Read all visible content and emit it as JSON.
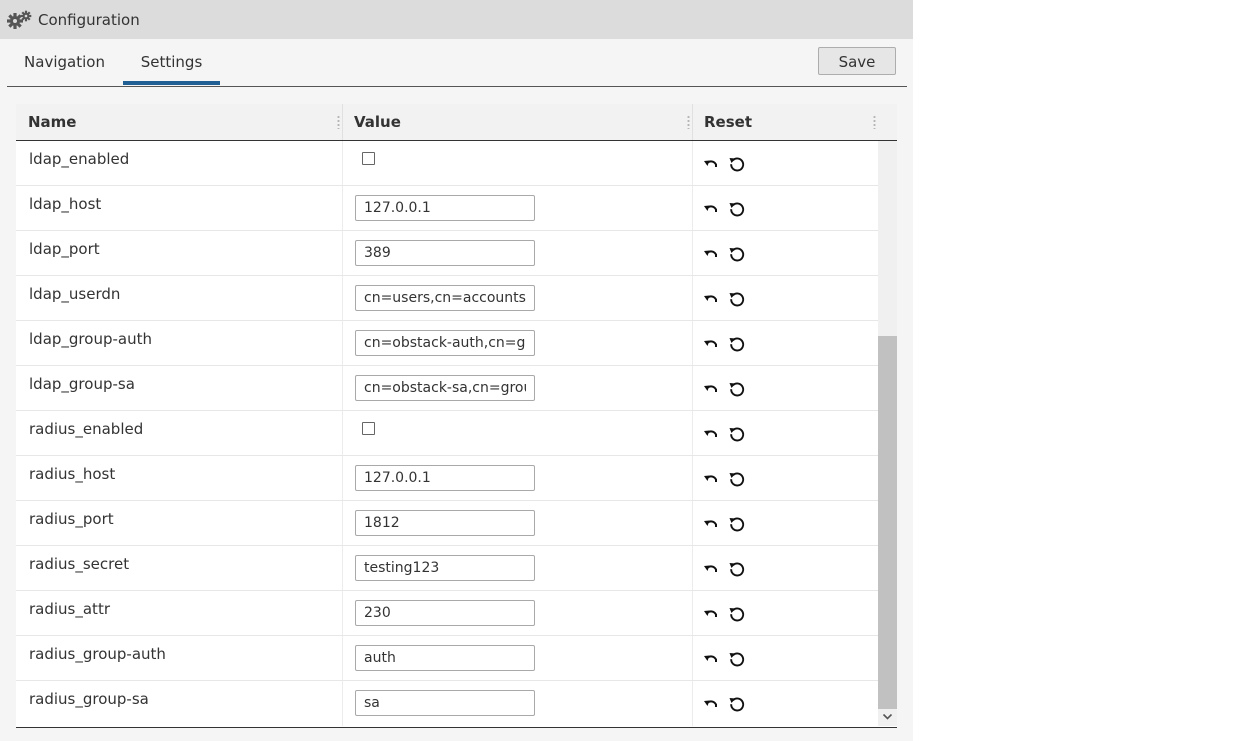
{
  "window": {
    "title": "Configuration",
    "icon": "gears-icon"
  },
  "tabs": [
    {
      "label": "Navigation",
      "active": false
    },
    {
      "label": "Settings",
      "active": true
    }
  ],
  "toolbar": {
    "save_label": "Save"
  },
  "grid": {
    "columns": [
      "Name",
      "Value",
      "Reset"
    ],
    "reset_icons": [
      "undo-icon",
      "reset-default-icon"
    ],
    "rows": [
      {
        "name": "ldap_enabled",
        "type": "checkbox",
        "checked": false,
        "value": ""
      },
      {
        "name": "ldap_host",
        "type": "text",
        "value": "127.0.0.1"
      },
      {
        "name": "ldap_port",
        "type": "text",
        "value": "389"
      },
      {
        "name": "ldap_userdn",
        "type": "text",
        "value": "cn=users,cn=accounts,"
      },
      {
        "name": "ldap_group-auth",
        "type": "text",
        "value": "cn=obstack-auth,cn=gr"
      },
      {
        "name": "ldap_group-sa",
        "type": "text",
        "value": "cn=obstack-sa,cn=grou"
      },
      {
        "name": "radius_enabled",
        "type": "checkbox",
        "checked": false,
        "value": ""
      },
      {
        "name": "radius_host",
        "type": "text",
        "value": "127.0.0.1"
      },
      {
        "name": "radius_port",
        "type": "text",
        "value": "1812"
      },
      {
        "name": "radius_secret",
        "type": "text",
        "value": "testing123"
      },
      {
        "name": "radius_attr",
        "type": "text",
        "value": "230"
      },
      {
        "name": "radius_group-auth",
        "type": "text",
        "value": "auth"
      },
      {
        "name": "radius_group-sa",
        "type": "text",
        "value": "sa"
      }
    ]
  },
  "colors": {
    "accent": "#1f5f94",
    "titlebar": "#dcdcdc"
  }
}
